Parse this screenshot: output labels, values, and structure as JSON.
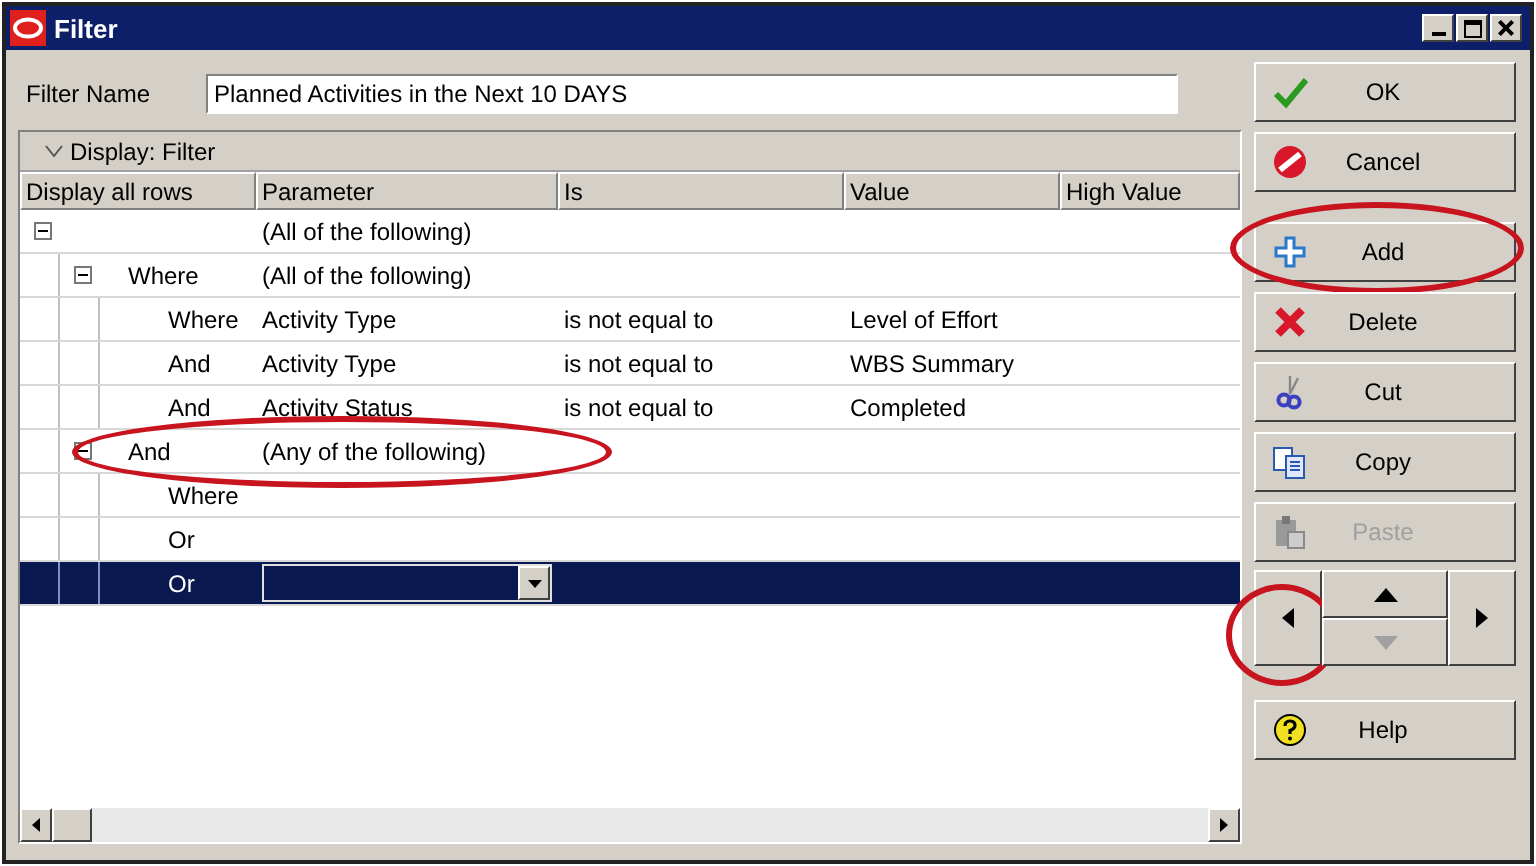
{
  "window": {
    "title": "Filter"
  },
  "filter_name": {
    "label": "Filter Name",
    "value": "Planned Activities in the Next 10 DAYS"
  },
  "section": {
    "label": "Display: Filter",
    "expanded": true
  },
  "table": {
    "columns": [
      "Display all rows",
      "Parameter",
      "Is",
      "Value",
      "High Value"
    ],
    "tree": [
      {
        "parameter": "(All of the following)",
        "expanded": true,
        "selected": false,
        "highlighted": false,
        "children": [
          {
            "connector": "Where",
            "parameter": "(All of the following)",
            "expanded": true,
            "selected": false,
            "highlighted": false,
            "children": [
              {
                "connector": "Where",
                "parameter": "Activity Type",
                "is": "is not equal to",
                "value": "Level of Effort",
                "selected": false,
                "highlighted": false
              },
              {
                "connector": "And",
                "parameter": "Activity Type",
                "is": "is not equal to",
                "value": "WBS Summary",
                "selected": false,
                "highlighted": false
              },
              {
                "connector": "And",
                "parameter": "Activity Status",
                "is": "is not equal to",
                "value": "Completed",
                "selected": false,
                "highlighted": false
              }
            ]
          },
          {
            "connector": "And",
            "parameter": "(Any of the following)",
            "expanded": true,
            "selected": false,
            "highlighted": true,
            "children": [
              {
                "connector": "Where",
                "selected": false,
                "highlighted": false
              },
              {
                "connector": "Or",
                "selected": false,
                "highlighted": false
              },
              {
                "connector": "Or",
                "selected": true,
                "highlighted": false
              }
            ]
          }
        ]
      }
    ]
  },
  "top_buttons": [
    {
      "label": "OK",
      "disabled": false,
      "highlighted": false
    },
    {
      "label": "Cancel",
      "disabled": false,
      "highlighted": false
    }
  ],
  "edit_buttons": [
    {
      "label": "Add",
      "disabled": false,
      "highlighted": true
    },
    {
      "label": "Delete",
      "disabled": false,
      "highlighted": false
    },
    {
      "label": "Cut",
      "disabled": false,
      "highlighted": false
    },
    {
      "label": "Copy",
      "disabled": false,
      "highlighted": false
    },
    {
      "label": "Paste",
      "disabled": true,
      "highlighted": false
    }
  ],
  "nav_buttons": [
    {
      "kind": "left",
      "disabled": false,
      "highlighted": true
    },
    {
      "kind": "up",
      "disabled": false,
      "highlighted": false
    },
    {
      "kind": "down",
      "disabled": true,
      "highlighted": false
    },
    {
      "kind": "right",
      "disabled": false,
      "highlighted": false
    }
  ],
  "help_button": {
    "label": "Help",
    "disabled": false,
    "highlighted": false
  }
}
